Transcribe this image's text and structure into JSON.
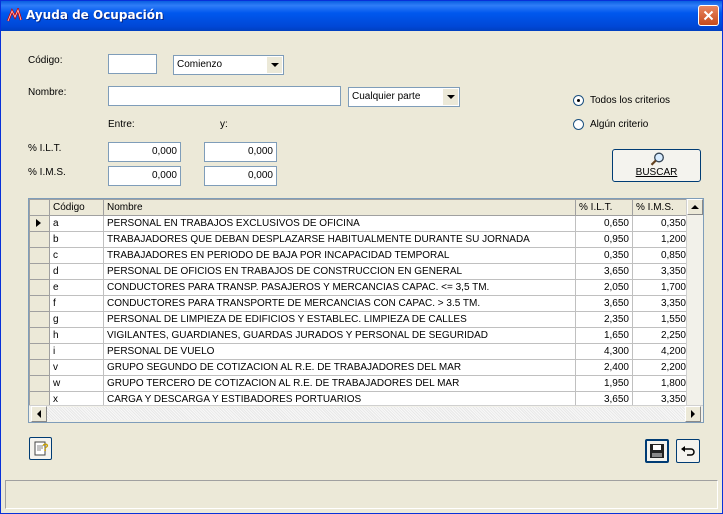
{
  "window": {
    "title": "Ayuda de Ocupación",
    "icon": "app-icon"
  },
  "filters": {
    "codigo_label": "Código:",
    "codigo_value": "",
    "codigo_match": "Comienzo",
    "nombre_label": "Nombre:",
    "nombre_value": "",
    "nombre_match": "Cualquier parte",
    "entre_label": "Entre:",
    "y_label": "y:",
    "ilt_label": "% I.L.T.",
    "ilt_from": "0,000",
    "ilt_to": "0,000",
    "ims_label": "% I.M.S.",
    "ims_from": "0,000",
    "ims_to": "0,000",
    "criteria_all": "Todos los criterios",
    "criteria_any": "Algún criterio",
    "criteria_selected": "all",
    "search_button": "BUSCAR"
  },
  "table": {
    "columns": [
      "Código",
      "Nombre",
      "% I.L.T.",
      "% I.M.S."
    ],
    "rows": [
      {
        "codigo": "a",
        "nombre": "PERSONAL EN TRABAJOS EXCLUSIVOS DE OFICINA",
        "ilt": "0,650",
        "ims": "0,350"
      },
      {
        "codigo": "b",
        "nombre": "TRABAJADORES QUE DEBAN DESPLAZARSE HABITUALMENTE DURANTE SU JORNADA",
        "ilt": "0,950",
        "ims": "1,200"
      },
      {
        "codigo": "c",
        "nombre": "TRABAJADORES EN PERIODO DE BAJA POR INCAPACIDAD TEMPORAL",
        "ilt": "0,350",
        "ims": "0,850"
      },
      {
        "codigo": "d",
        "nombre": "PERSONAL DE OFICIOS EN TRABAJOS DE CONSTRUCCION EN GENERAL",
        "ilt": "3,650",
        "ims": "3,350"
      },
      {
        "codigo": "e",
        "nombre": "CONDUCTORES PARA TRANSP. PASAJEROS Y MERCANCIAS CAPAC. <= 3,5 TM.",
        "ilt": "2,050",
        "ims": "1,700"
      },
      {
        "codigo": "f",
        "nombre": "CONDUCTORES PARA TRANSPORTE DE MERCANCIAS CON CAPAC. > 3.5 TM.",
        "ilt": "3,650",
        "ims": "3,350"
      },
      {
        "codigo": "g",
        "nombre": "PERSONAL DE LIMPIEZA DE EDIFICIOS Y ESTABLEC. LIMPIEZA DE CALLES",
        "ilt": "2,350",
        "ims": "1,550"
      },
      {
        "codigo": "h",
        "nombre": "VIGILANTES, GUARDIANES, GUARDAS JURADOS Y PERSONAL DE SEGURIDAD",
        "ilt": "1,650",
        "ims": "2,250"
      },
      {
        "codigo": "i",
        "nombre": "PERSONAL DE VUELO",
        "ilt": "4,300",
        "ims": "4,200"
      },
      {
        "codigo": "v",
        "nombre": "GRUPO SEGUNDO DE COTIZACION AL R.E. DE TRABAJADORES DEL MAR",
        "ilt": "2,400",
        "ims": "2,200"
      },
      {
        "codigo": "w",
        "nombre": "GRUPO TERCERO DE COTIZACION AL R.E. DE TRABAJADORES DEL MAR",
        "ilt": "1,950",
        "ims": "1,800"
      },
      {
        "codigo": "x",
        "nombre": "CARGA Y DESCARGA Y ESTIBADORES PORTUARIOS",
        "ilt": "3,650",
        "ims": "3,350"
      }
    ],
    "selected_row": 0
  },
  "footer": {
    "help_icon": "help-icon",
    "save_icon": "save-icon",
    "undo_icon": "undo-icon",
    "status_text": ""
  }
}
